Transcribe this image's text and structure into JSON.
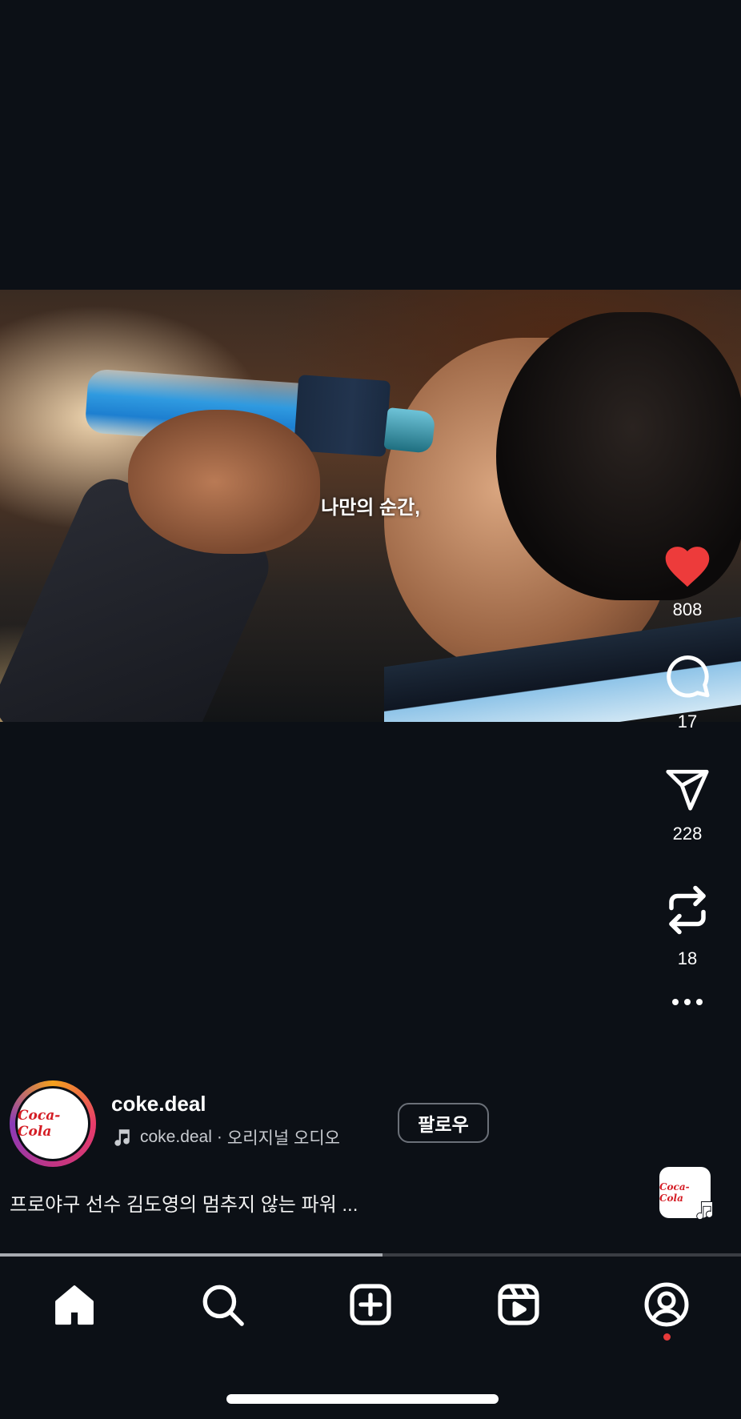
{
  "video": {
    "caption": "나만의 순간,"
  },
  "actions": {
    "like": {
      "count": "808",
      "icon": "heart-icon",
      "color": "#ed3b3b"
    },
    "comment": {
      "count": "17",
      "icon": "comment-icon"
    },
    "share": {
      "count": "228",
      "icon": "send-icon"
    },
    "remix": {
      "count": "18",
      "icon": "repost-icon"
    },
    "more": {
      "icon": "more-icon"
    }
  },
  "post": {
    "username": "coke.deal",
    "avatar_text": "Coca-Cola",
    "audio_name": "coke.deal",
    "audio_separator": "·",
    "audio_type": "오리지널 오디오",
    "follow_label": "팔로우",
    "description": "프로야구 선수 김도영의 멈추지 않는 파워 ..."
  },
  "progress": {
    "fraction": 0.516
  },
  "nav": {
    "items": [
      "home-icon",
      "search-icon",
      "create-icon",
      "reels-icon",
      "profile-icon"
    ],
    "notification_dot_color": "#e63a3a"
  }
}
